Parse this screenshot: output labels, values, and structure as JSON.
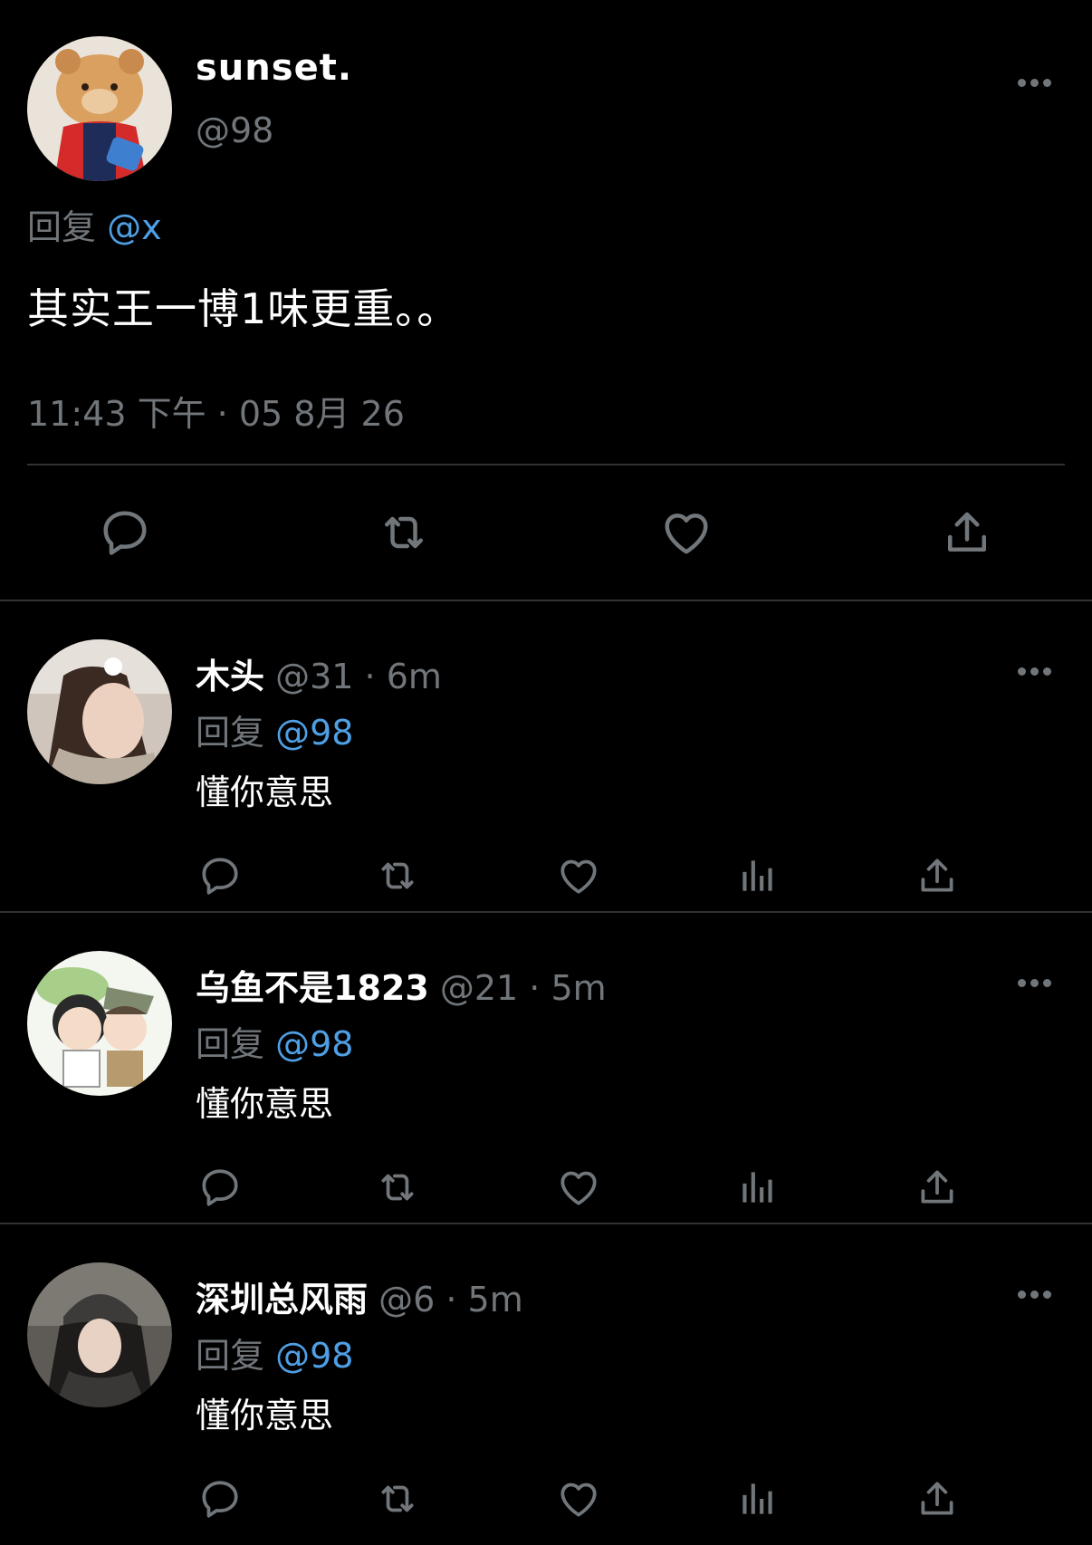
{
  "main_tweet": {
    "display_name": "sunset.",
    "handle": "@98",
    "replying_label": "回复",
    "replying_to": "@x",
    "text": "其实王一博1味更重。。",
    "timestamp": "11:43 下午 · 05 8月 26",
    "actions": [
      "reply-icon",
      "retweet-icon",
      "like-icon",
      "share-icon"
    ]
  },
  "replies": [
    {
      "display_name": "木头",
      "meta": "@31 · 6m",
      "replying_label": "回复",
      "replying_to": "@98",
      "text": "懂你意思"
    },
    {
      "display_name": "乌鱼不是1823",
      "meta": "@21 · 5m",
      "replying_label": "回复",
      "replying_to": "@98",
      "text": "懂你意思"
    },
    {
      "display_name": "深圳总风雨",
      "meta": "@6 · 5m",
      "replying_label": "回复",
      "replying_to": "@98",
      "text": "懂你意思"
    }
  ],
  "reply_actions": [
    "reply-icon",
    "retweet-icon",
    "like-icon",
    "views-icon",
    "share-icon"
  ],
  "colors": {
    "background": "#000000",
    "primary_text": "#ffffff",
    "secondary_text": "#71767b",
    "mention": "#4f9fe4",
    "divider": "#2f3336"
  }
}
